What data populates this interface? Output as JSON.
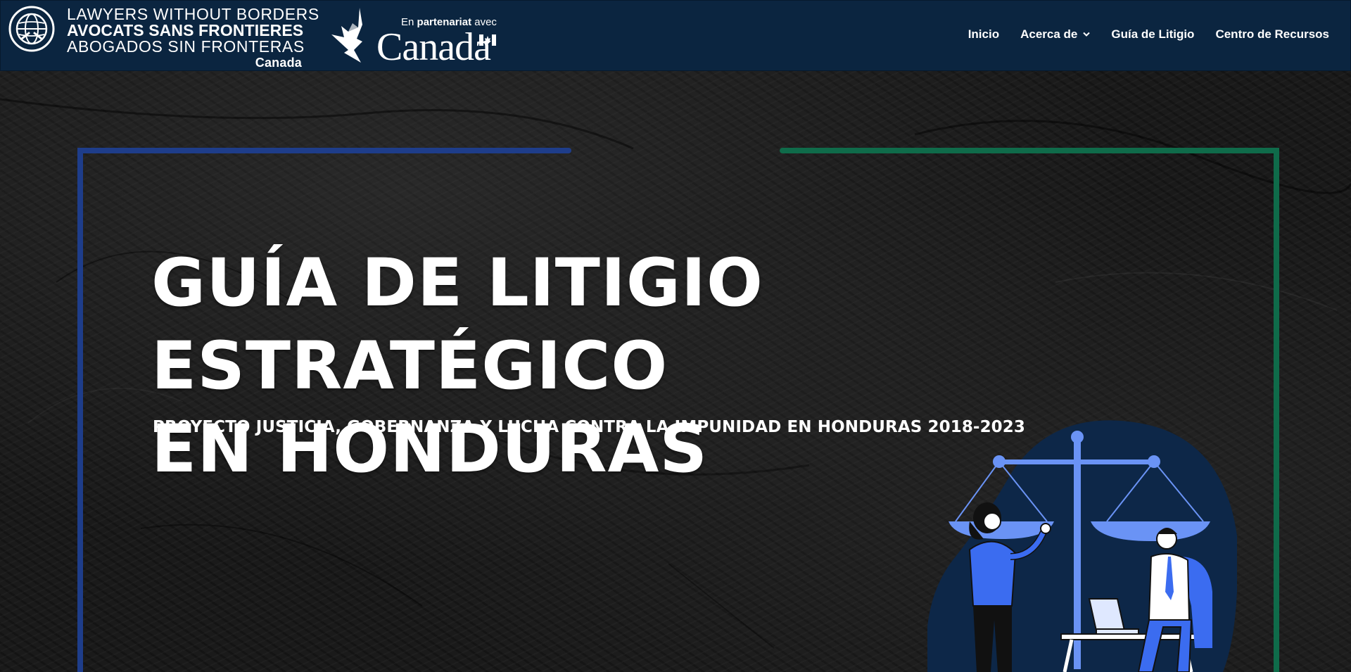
{
  "header": {
    "brand": {
      "line1": "LAWYERS WITHOUT BORDERS",
      "line2": "AVOCATS SANS FRONTIERES",
      "line3": "ABOGADOS SIN FRONTERAS",
      "country": "Canada"
    },
    "partner": {
      "prefix": "En",
      "bold": "partenariat",
      "suffix": "avec",
      "wordmark": "Canad",
      "wordmark_last": "a"
    },
    "nav": [
      {
        "label": "Inicio"
      },
      {
        "label": "Acerca de",
        "has_dropdown": true
      },
      {
        "label": "Guía de Litigio"
      },
      {
        "label": "Centro de Recursos"
      }
    ]
  },
  "hero": {
    "title_line1": "GUÍA DE LITIGIO ESTRATÉGICO",
    "title_line2": "EN HONDURAS",
    "subtitle": "PROYECTO JUSTICIA, GOBERNANZA Y LUCHA CONTRA LA IMPUNIDAD EN HONDURAS 2018-2023"
  },
  "colors": {
    "header_bg": "#0b2540",
    "frame_blue": "#1e3d8a",
    "frame_green": "#0f6b4a",
    "illustration_navy": "#0d2748",
    "illustration_blue": "#3b6cf0"
  },
  "icons": [
    "globe-hands-logo-icon",
    "maple-leaf-icon",
    "canada-flag-icon",
    "chevron-down-icon",
    "justice-scale-illustration"
  ]
}
